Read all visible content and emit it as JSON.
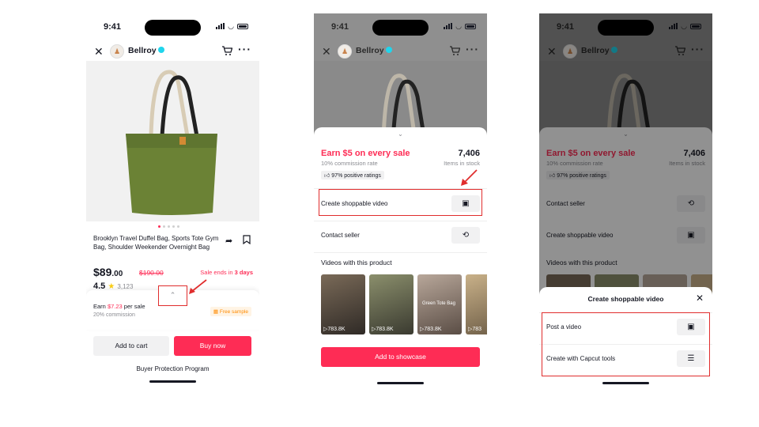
{
  "status": {
    "time": "9:41"
  },
  "seller": {
    "name": "Bellroy"
  },
  "product": {
    "title": "Brooklyn Travel Duffel Bag, Sports Tote Gym Bag, Shoulder Weekender Overnight Bag",
    "price_main": "$89",
    "price_cents": ".00",
    "old_price": "$190.00",
    "sale_prefix": "Sale ends in ",
    "sale_days": "3 days",
    "rating": "4.5",
    "rating_count": "3,123",
    "image_count": 5,
    "image_index": 1
  },
  "earn_card": {
    "earn_prefix": "Earn ",
    "earn_amount": "$7.23",
    "earn_suffix": " per sale",
    "commission": "20% commission",
    "free_sample": "Free sample"
  },
  "actions": {
    "add_to_cart": "Add to cart",
    "buy_now": "Buy now",
    "buyer_protection": "Buyer Protection Program"
  },
  "sheet": {
    "earn_prefix": "Earn ",
    "earn_amount": "$5",
    "earn_suffix": " on every sale",
    "commission_rate": "10% commission rate",
    "stock": "7,406",
    "stock_label": "Items in stock",
    "positive": "97% positive ratings",
    "create_video": "Create shoppable video",
    "contact_seller": "Contact seller",
    "videos_title": "Videos with this product",
    "video_views": [
      "783.8K",
      "783.8K",
      "783.8K",
      "783"
    ],
    "video_caption": "Green Tote Bag",
    "add_showcase": "Add to showcase"
  },
  "modal": {
    "title": "Create shoppable video",
    "post_video": "Post a video",
    "capcut": "Create with Capcut tools"
  },
  "colors": {
    "accent": "#fe2c55",
    "highlight": "#e02d2d",
    "bag": "#6b8235"
  }
}
